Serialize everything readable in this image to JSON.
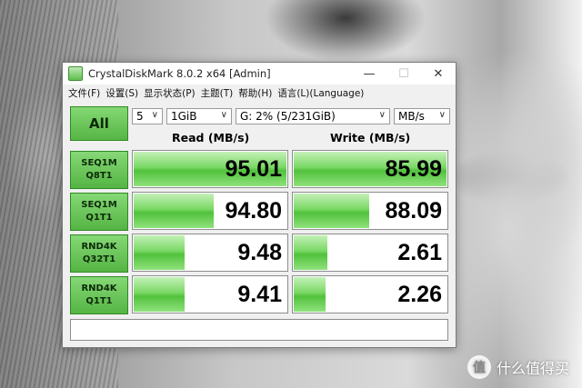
{
  "window": {
    "title": "CrystalDiskMark 8.0.2 x64 [Admin]",
    "controls": {
      "minimize": "—",
      "maximize": "☐",
      "close": "✕"
    }
  },
  "menu": [
    "文件(F)",
    "设置(S)",
    "显示状态(P)",
    "主题(T)",
    "帮助(H)",
    "语言(L)(Language)"
  ],
  "toolbar": {
    "all_label": "All",
    "count": "5",
    "size": "1GiB",
    "drive": "G: 2% (5/231GiB)",
    "unit": "MB/s"
  },
  "headers": {
    "read": "Read (MB/s)",
    "write": "Write (MB/s)"
  },
  "tests": [
    {
      "line1": "SEQ1M",
      "line2": "Q8T1",
      "read": "95.01",
      "write": "85.99",
      "read_fill": 1.0,
      "write_fill": 1.0
    },
    {
      "line1": "SEQ1M",
      "line2": "Q1T1",
      "read": "94.80",
      "write": "88.09",
      "read_fill": 0.53,
      "write_fill": 0.5
    },
    {
      "line1": "RND4K",
      "line2": "Q32T1",
      "read": "9.48",
      "write": "2.61",
      "read_fill": 0.34,
      "write_fill": 0.23
    },
    {
      "line1": "RND4K",
      "line2": "Q1T1",
      "read": "9.41",
      "write": "2.26",
      "read_fill": 0.34,
      "write_fill": 0.22
    }
  ],
  "comment": "",
  "watermark": {
    "logo": "值",
    "text": "什么值得买"
  },
  "colors": {
    "accent_green": "#56b545",
    "bar_green": "#52c13d"
  }
}
